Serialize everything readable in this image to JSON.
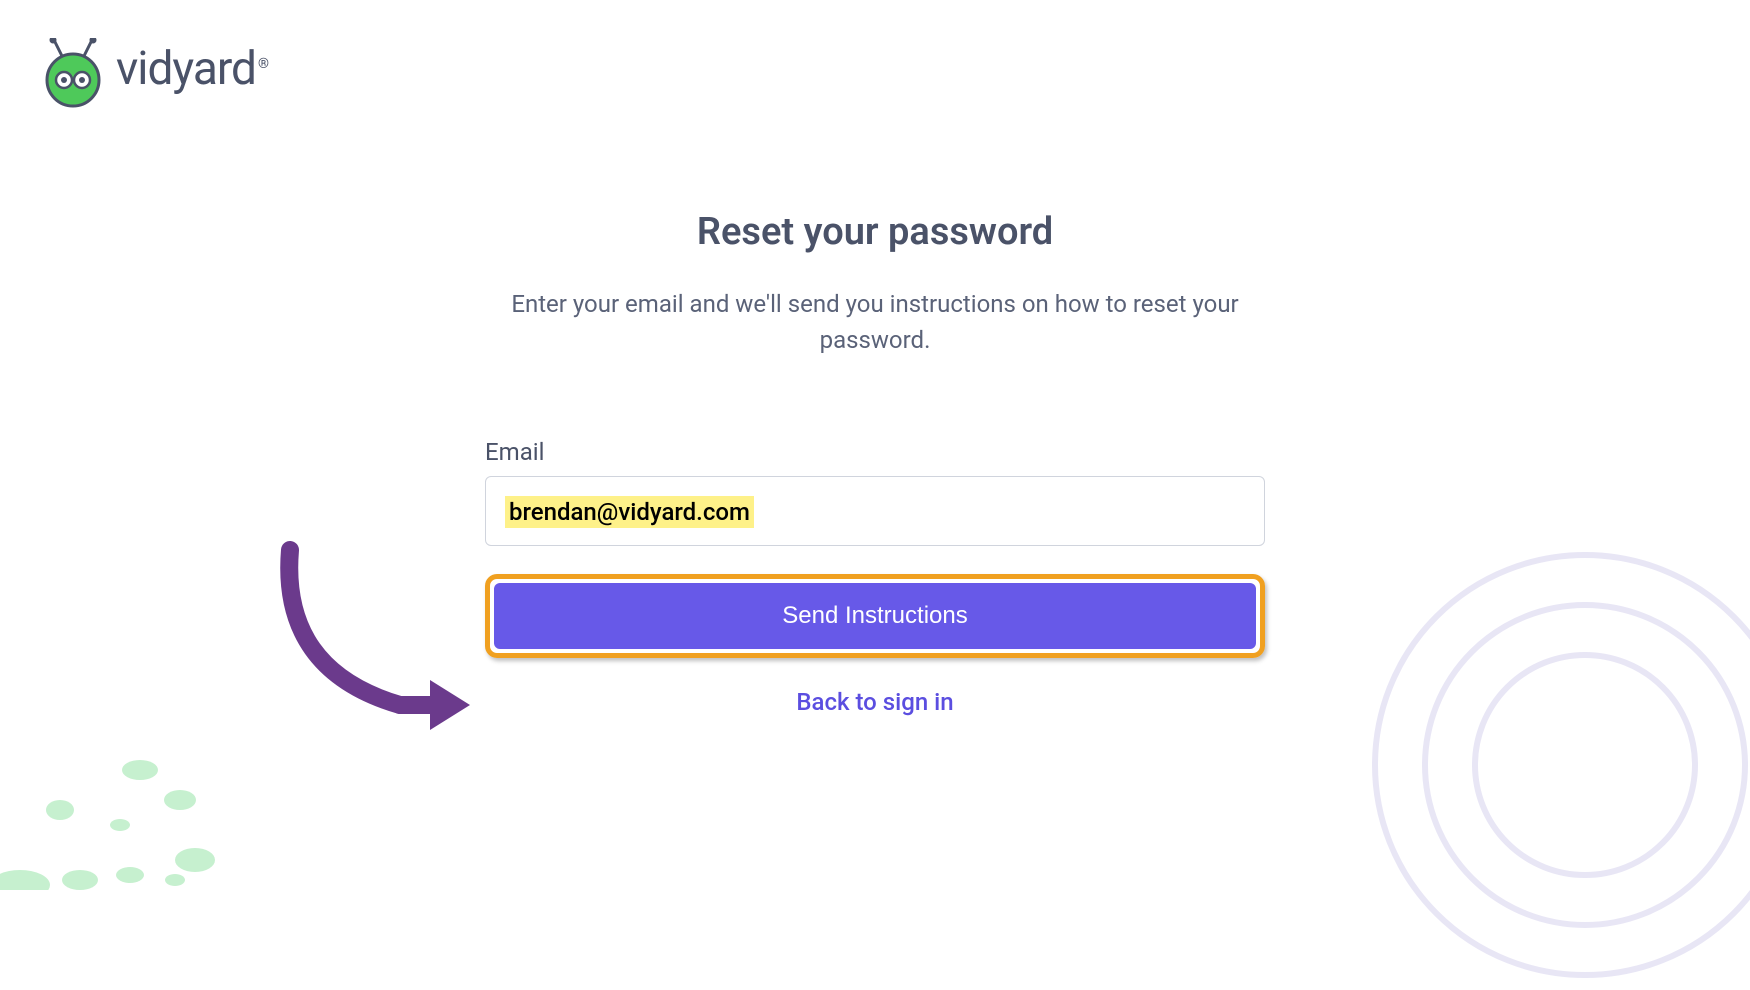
{
  "logo": {
    "brand_name": "vidyard"
  },
  "page": {
    "title": "Reset your password",
    "subtitle": "Enter your email and we'll send you instructions on how to reset your password."
  },
  "form": {
    "email_label": "Email",
    "email_value": "brendan@vidyard.com",
    "submit_label": "Send Instructions",
    "back_link_label": "Back to sign in"
  }
}
